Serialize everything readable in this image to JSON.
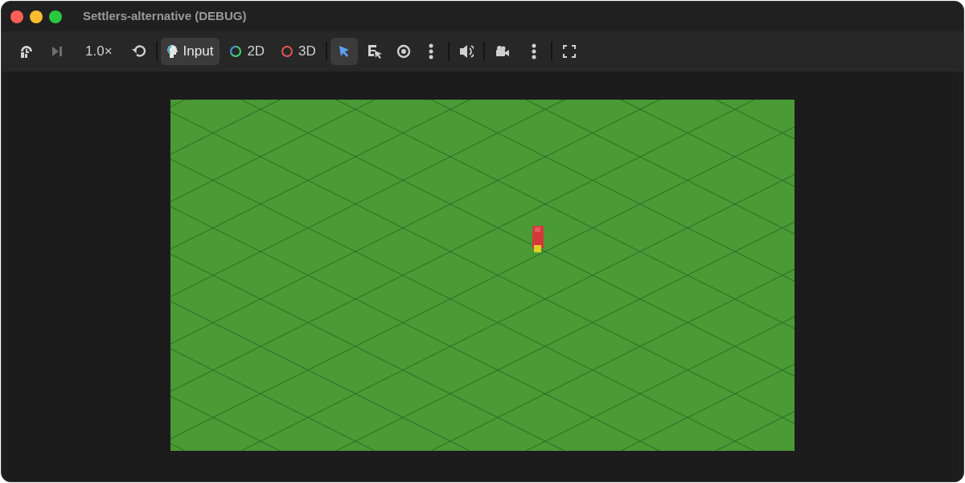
{
  "window": {
    "title": "Settlers-alternative (DEBUG)"
  },
  "toolbar": {
    "step_enabled": false,
    "speed": "1.0×",
    "modes": [
      {
        "kind": "input",
        "label": "Input",
        "selected": true
      },
      {
        "kind": "flat",
        "label": "2D",
        "selected": false
      },
      {
        "kind": "spatial",
        "label": "3D",
        "selected": false
      }
    ],
    "select_tools": [
      {
        "selected": true
      },
      {
        "selected": false
      }
    ]
  }
}
